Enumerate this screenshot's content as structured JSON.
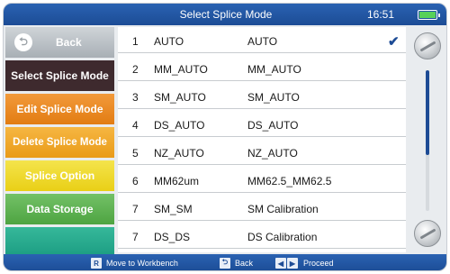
{
  "titlebar": {
    "title": "Select Splice Mode",
    "time": "16:51",
    "battery_icon": "battery-icon"
  },
  "sidebar": {
    "back": "Back",
    "items": [
      {
        "label": "Select Splice Mode",
        "color": "#3e2a2e"
      },
      {
        "label": "Edit Splice Mode",
        "color": "#e88420"
      },
      {
        "label": "Delete Splice Mode",
        "color": "#f0a82c"
      },
      {
        "label": "Splice Option",
        "color": "#efdc30"
      },
      {
        "label": "Data Storage",
        "color": "#5fb253"
      }
    ]
  },
  "modes": [
    {
      "num": "1",
      "name": "AUTO",
      "desc": "AUTO",
      "selected": true
    },
    {
      "num": "2",
      "name": "MM_AUTO",
      "desc": "MM_AUTO"
    },
    {
      "num": "3",
      "name": "SM_AUTO",
      "desc": "SM_AUTO"
    },
    {
      "num": "4",
      "name": "DS_AUTO",
      "desc": "DS_AUTO"
    },
    {
      "num": "5",
      "name": "NZ_AUTO",
      "desc": "NZ_AUTO"
    },
    {
      "num": "6",
      "name": "MM62um",
      "desc": "MM62.5_MM62.5"
    },
    {
      "num": "7",
      "name": "SM_SM",
      "desc": "SM Calibration"
    },
    {
      "num": "7",
      "name": "DS_DS",
      "desc": "DS Calibration"
    }
  ],
  "selected_mark": "✔",
  "footer": {
    "workbench_key": "R",
    "workbench_label": "Move to Workbench",
    "back_key": "⮌",
    "back_label": "Back",
    "proceed_keys": [
      "◀",
      "▶"
    ],
    "proceed_label": "Proceed"
  },
  "scroll": {
    "position_fraction": 0.0,
    "visible_fraction": 0.6
  }
}
